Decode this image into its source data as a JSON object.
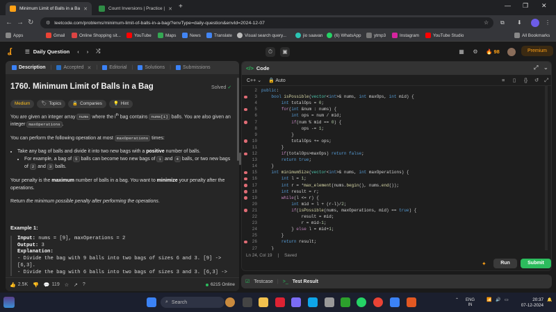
{
  "browser": {
    "tabs": [
      {
        "title": "Minimum Limit of Balls in a Bag",
        "active": true
      },
      {
        "title": "Count Inversions | Practice | Gee",
        "active": false
      }
    ],
    "url": "leetcode.com/problems/minimum-limit-of-balls-in-a-bag/?envType=daily-question&envId=2024-12-07",
    "bookmarks": [
      "Apps",
      "Gmail",
      "Online Shopping sit...",
      "YouTube",
      "Maps",
      "News",
      "Translate",
      "Visual search query...",
      "jio saavan",
      "(6) WhatsApp",
      "ytmp3",
      "Instagram",
      "YouTube Studio",
      "All Bookmarks"
    ]
  },
  "topbar": {
    "title": "Daily Question",
    "streak": "98",
    "premium": "Premium"
  },
  "left": {
    "tabs": [
      "Description",
      "Accepted",
      "Editorial",
      "Solutions",
      "Submissions"
    ],
    "title": "1760. Minimum Limit of Balls in a Bag",
    "solved": "Solved",
    "chips": [
      "Medium",
      "Topics",
      "Companies",
      "Hint"
    ],
    "p1a": "You are given an integer array ",
    "p1_nums": "nums",
    "p1b": " where the ",
    "p1_ith": "i",
    "p1_th": "th",
    "p1c": " bag contains ",
    "p1_numsi": "nums[i]",
    "p1d": " balls. You are also given an integer ",
    "p1_maxops": "maxOperations",
    "p1e": ".",
    "p2a": "You can perform the following operation at most ",
    "p2_maxops": "maxOperations",
    "p2b": " times:",
    "b1a": "Take any bag of balls and divide it into two new bags with a ",
    "b1_pos": "positive",
    "b1b": " number of balls.",
    "b2a": "For example, a bag of ",
    "b2_5": "5",
    "b2b": " balls can become two new bags of ",
    "b2_1": "1",
    "b2c": " and ",
    "b2_4": "4",
    "b2d": " balls, or two new bags of ",
    "b2_2": "2",
    "b2e": " and ",
    "b2_3": "3",
    "b2f": " balls.",
    "p3a": "Your penalty is the ",
    "p3_max": "maximum",
    "p3b": " number of balls in a bag. You want to ",
    "p3_min": "minimize",
    "p3c": " your penalty after the operations.",
    "p4a": "Return ",
    "p4_it": "the minimum possible penalty after performing the operations",
    "p4b": ".",
    "example_title": "Example 1:",
    "ex_input_label": "Input:",
    "ex_input": " nums = [9], maxOperations = 2",
    "ex_output_label": "Output:",
    "ex_output": " 3",
    "ex_expl_label": "Explanation:",
    "ex_l1": "- Divide the bag with 9 balls into two bags of sizes 6 and 3. [9] ->",
    "ex_l2": "[6,3].",
    "ex_l3": "- Divide the bag with 6 balls into two bags of sizes 3 and 3. [6,3] ->",
    "footer": {
      "likes": "2.5K",
      "comments": "119",
      "online": "6215 Online"
    }
  },
  "code": {
    "header": "Code",
    "language": "C++",
    "autosave": "Auto",
    "status_pos": "Ln 24, Col 19",
    "status_saved": "Saved",
    "run": "Run",
    "submit": "Submit"
  },
  "codelines": [
    {
      "n": "2",
      "bp": false,
      "t": "public:"
    },
    {
      "n": "3",
      "bp": true,
      "t": "    bool isPossible(vector<int>& nums, int maxOps, int mid) {"
    },
    {
      "n": "4",
      "bp": false,
      "t": "        int totalOps = 0;"
    },
    {
      "n": "5",
      "bp": true,
      "t": "        for(int &num : nums) {"
    },
    {
      "n": "6",
      "bp": false,
      "t": "            int ops = num / mid;"
    },
    {
      "n": "7",
      "bp": true,
      "t": "            if(num % mid == 0) {"
    },
    {
      "n": "8",
      "bp": false,
      "t": "                ops -= 1;"
    },
    {
      "n": "9",
      "bp": false,
      "t": "            }"
    },
    {
      "n": "10",
      "bp": true,
      "t": "            totalOps += ops;"
    },
    {
      "n": "11",
      "bp": false,
      "t": "        }"
    },
    {
      "n": "12",
      "bp": true,
      "t": "        if(totalOps>maxOps) return false;"
    },
    {
      "n": "13",
      "bp": false,
      "t": "        return true;"
    },
    {
      "n": "14",
      "bp": false,
      "t": "    }"
    },
    {
      "n": "15",
      "bp": true,
      "t": "    int minimumSize(vector<int>& nums, int maxOperations) {"
    },
    {
      "n": "16",
      "bp": true,
      "t": "        int l = 1;"
    },
    {
      "n": "17",
      "bp": true,
      "t": "        int r = *max_element(nums.begin(), nums.end());"
    },
    {
      "n": "18",
      "bp": true,
      "t": "        int result = r;"
    },
    {
      "n": "19",
      "bp": true,
      "t": "        while(l <= r) {"
    },
    {
      "n": "20",
      "bp": false,
      "t": "            int mid = l + (r-l)/2;"
    },
    {
      "n": "21",
      "bp": true,
      "t": "            if(isPossible(nums, maxOperations, mid) == true) {"
    },
    {
      "n": "22",
      "bp": false,
      "t": "                result = mid;"
    },
    {
      "n": "23",
      "bp": false,
      "t": "                r = mid-1;"
    },
    {
      "n": "24",
      "bp": false,
      "t": "            } else l = mid+1;"
    },
    {
      "n": "25",
      "bp": false,
      "t": "        }"
    },
    {
      "n": "26",
      "bp": true,
      "t": "        return result;"
    },
    {
      "n": "27",
      "bp": false,
      "t": "    }"
    }
  ],
  "bottom": {
    "testcase": "Testcase",
    "testresult": "Test Result"
  },
  "taskbar": {
    "search": "Search",
    "lang1": "ENG",
    "lang2": "IN",
    "time": "20:37",
    "date": "07-12-2024"
  },
  "colors": {
    "accent": "#ffa116",
    "green": "#2cbb5d",
    "breakpoint": "#e06c75"
  }
}
